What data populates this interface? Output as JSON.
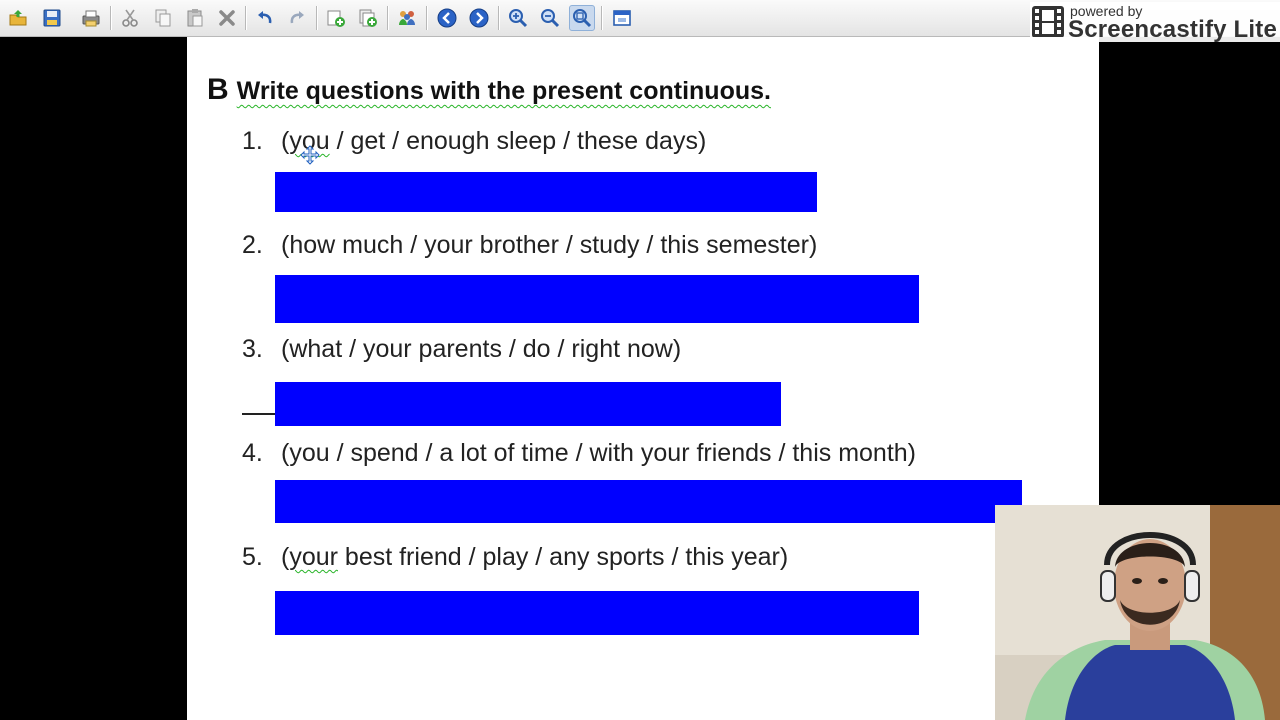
{
  "toolbar": {
    "buttons": [
      {
        "id": "open",
        "icon": "open-folder-icon"
      },
      {
        "id": "save",
        "icon": "save-icon"
      },
      {
        "id": "print",
        "icon": "print-icon"
      },
      {
        "id": "cut",
        "icon": "cut-icon"
      },
      {
        "id": "copy",
        "icon": "copy-icon"
      },
      {
        "id": "paste",
        "icon": "paste-icon"
      },
      {
        "id": "delete",
        "icon": "delete-icon"
      },
      {
        "id": "undo",
        "icon": "undo-icon"
      },
      {
        "id": "redo",
        "icon": "redo-icon"
      },
      {
        "id": "new-page",
        "icon": "new-page-icon"
      },
      {
        "id": "duplicate-page",
        "icon": "duplicate-page-icon"
      },
      {
        "id": "users",
        "icon": "users-icon"
      },
      {
        "id": "previous-page",
        "icon": "arrow-left-icon"
      },
      {
        "id": "next-page",
        "icon": "arrow-right-icon"
      },
      {
        "id": "zoom-in",
        "icon": "zoom-in-icon"
      },
      {
        "id": "zoom-out",
        "icon": "zoom-out-icon"
      },
      {
        "id": "zoom-fit",
        "icon": "zoom-fit-icon",
        "active": true
      },
      {
        "id": "full-screen",
        "icon": "full-screen-icon"
      }
    ]
  },
  "branding": {
    "small": "powered by",
    "name": "Screencastify Lite"
  },
  "document": {
    "letter": "B",
    "title": "Write questions with the present continuous.",
    "questions": [
      {
        "num": "1.",
        "underlined": "you",
        "rest": " / get / enough sleep / these days)"
      },
      {
        "num": "2.",
        "underlined": "",
        "rest": "how much / your brother / study / this semester)"
      },
      {
        "num": "3.",
        "underlined": "",
        "rest": "what / your parents / do / right now)"
      },
      {
        "num": "4.",
        "underlined": "",
        "rest": "you / spend / a lot of time / with your friends / this month)"
      },
      {
        "num": "5.",
        "underlined": "your",
        "rest": " best friend / play / any sports / this year)"
      }
    ],
    "answer_bar_color": "#0000ff"
  },
  "webcam": {
    "description_icon": "webcam-feed"
  }
}
